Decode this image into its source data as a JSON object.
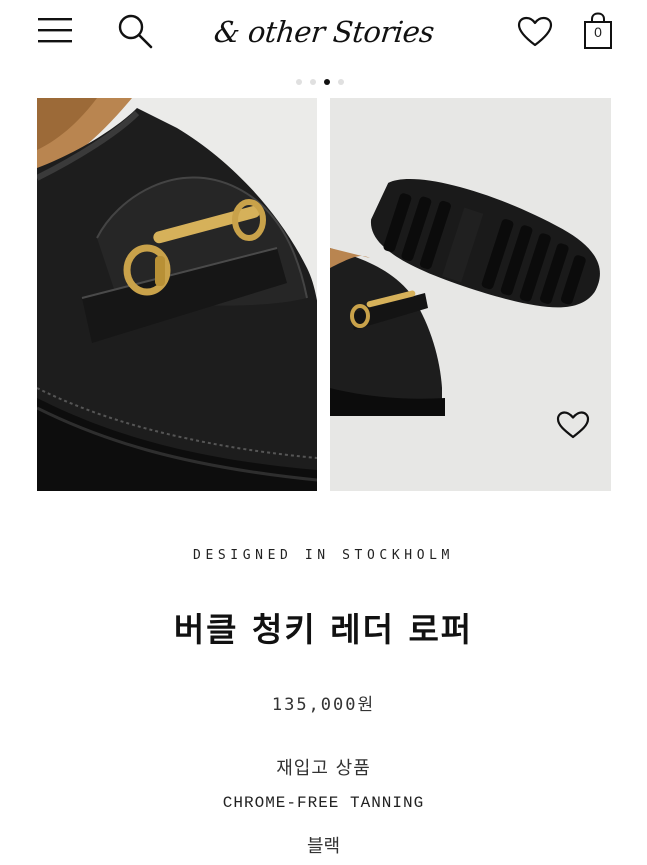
{
  "header": {
    "logo_text": "& other Stories",
    "bag_count": "0",
    "icons": {
      "menu": "hamburger-menu-icon",
      "search": "search-icon",
      "wishlist": "heart-icon",
      "bag": "shopping-bag-icon"
    }
  },
  "carousel": {
    "dot_count": 4,
    "active_index": 2
  },
  "gallery": {
    "images": [
      {
        "subject": "loafer-closeup"
      },
      {
        "subject": "loafer-pair-sole"
      }
    ],
    "favorite_icon": "heart-icon"
  },
  "product": {
    "designed_in": "DESIGNED IN STOCKHOLM",
    "title": "버클 청키 레더 로퍼",
    "price": "135,000원",
    "restock_label": "재입고 상품",
    "feature": "CHROME-FREE TANNING",
    "color": "블랙"
  },
  "colors": {
    "text": "#1a1a1a",
    "leather": "#1c1c1c",
    "hardware": "#c9a24a",
    "lining": "#b07a45",
    "background": "#e8e8e6"
  }
}
